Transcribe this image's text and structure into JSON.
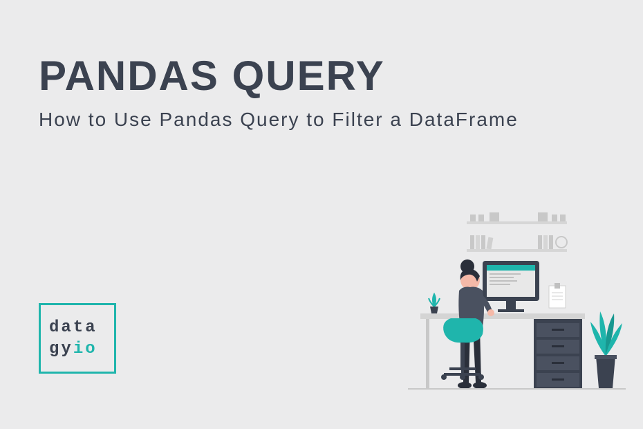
{
  "title": "PANDAS QUERY",
  "subtitle": "How to Use Pandas Query to Filter a DataFrame",
  "logo": {
    "line1": "data",
    "line2_a": "gy",
    "line2_b": "io"
  },
  "colors": {
    "background": "#ebebec",
    "text": "#3b4250",
    "accent": "#1fb5ac"
  }
}
